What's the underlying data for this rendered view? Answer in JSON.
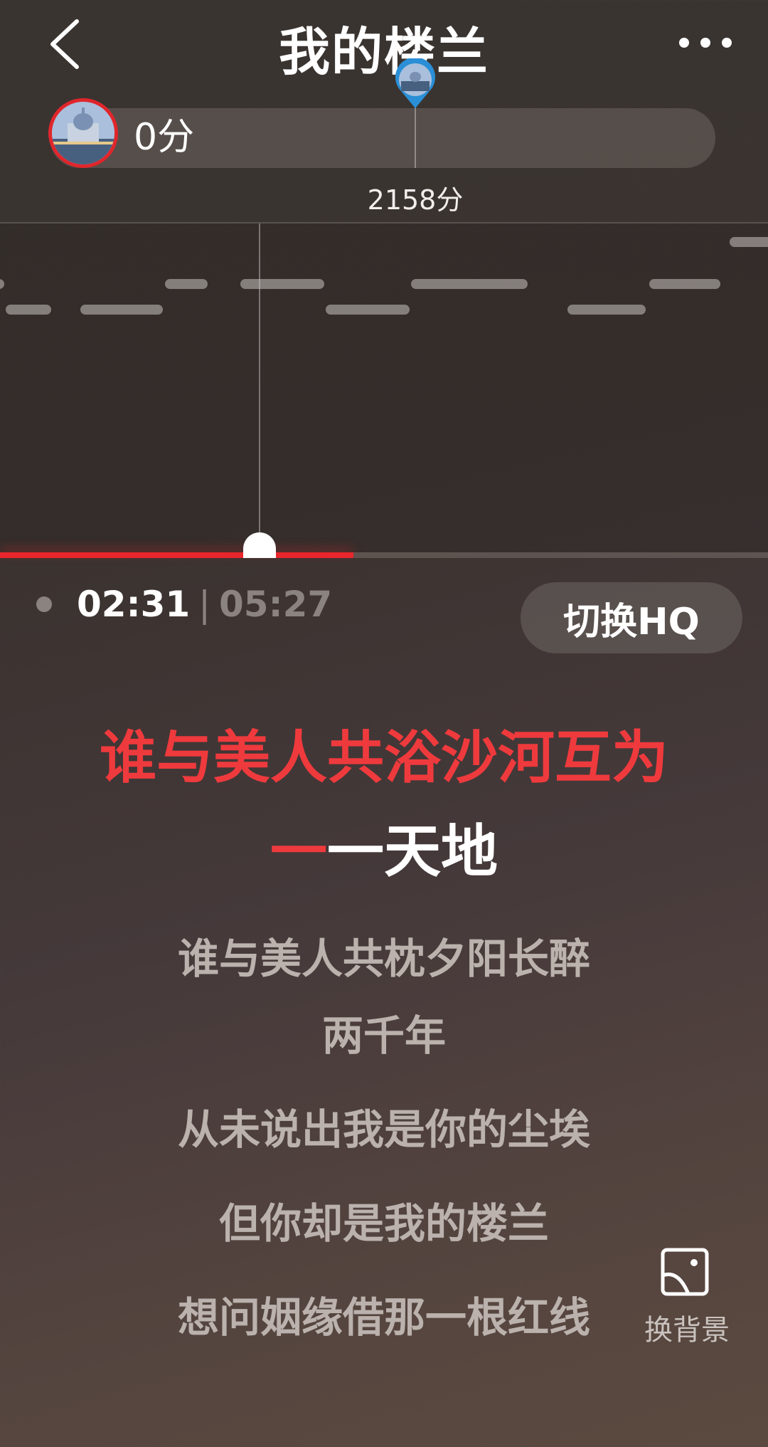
{
  "header": {
    "title": "我的楼兰",
    "back_icon": "chevron-left-icon",
    "more_icon": "more-dots-icon"
  },
  "score": {
    "current": "0分",
    "target": "2158分"
  },
  "playback": {
    "current_time": "02:31",
    "separator": "|",
    "total_time": "05:27",
    "progress_fraction": 0.46
  },
  "actions": {
    "hq_button": "切换HQ",
    "change_background": "换背景"
  },
  "lyrics": {
    "current_line1": "谁与美人共浴沙河互为",
    "current_line2_sung": "一",
    "current_line2_rest": "一天地",
    "upcoming": [
      "谁与美人共枕夕阳长醉",
      "两千年",
      "从未说出我是你的尘埃",
      "但你却是我的楼兰",
      "想问姻缘借那一根红线"
    ]
  },
  "colors": {
    "accent": "#ef3a3d",
    "progress": "#e8262b",
    "lyric_dim": "#bbb2ad"
  }
}
